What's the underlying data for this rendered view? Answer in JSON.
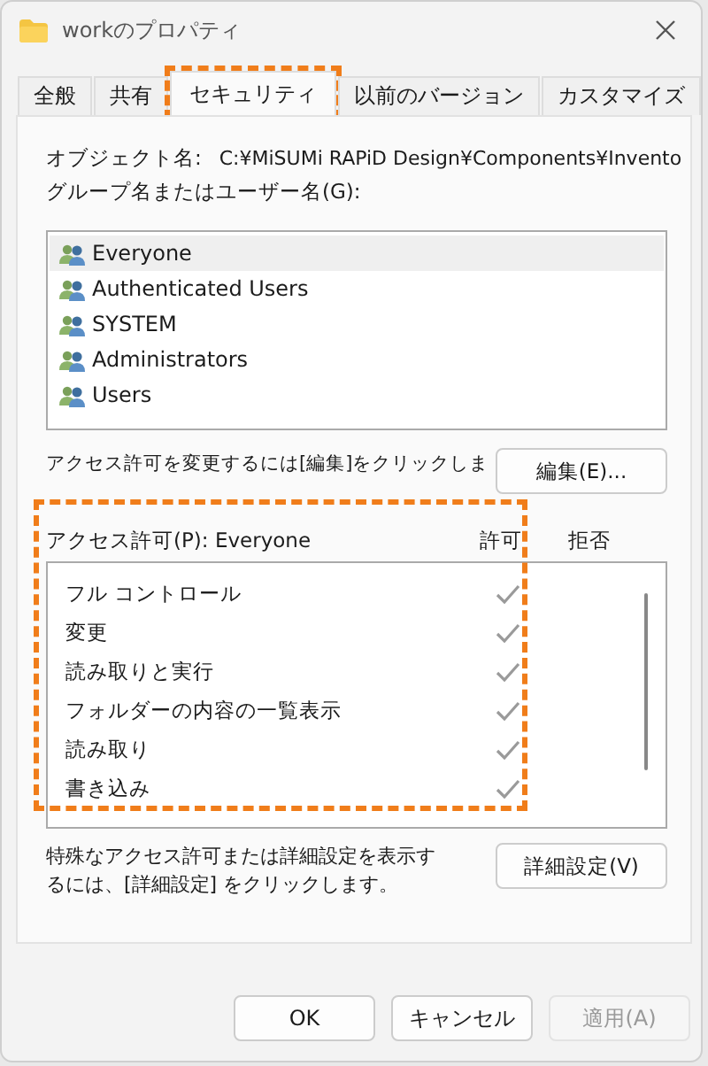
{
  "window": {
    "title": "workのプロパティ"
  },
  "tabs": [
    {
      "label": "全般",
      "selected": false,
      "highlighted": false
    },
    {
      "label": "共有",
      "selected": false,
      "highlighted": false
    },
    {
      "label": "セキュリティ",
      "selected": true,
      "highlighted": true
    },
    {
      "label": "以前のバージョン",
      "selected": false,
      "highlighted": false
    },
    {
      "label": "カスタマイズ",
      "selected": false,
      "highlighted": false
    }
  ],
  "object_name": {
    "label": "オブジェクト名:",
    "value": "C:¥MiSUMi RAPiD Design¥Components¥Invento"
  },
  "groups": {
    "label": "グループ名またはユーザー名(G):",
    "items": [
      {
        "name": "Everyone",
        "selected": true
      },
      {
        "name": "Authenticated Users",
        "selected": false
      },
      {
        "name": "SYSTEM",
        "selected": false
      },
      {
        "name": "Administrators",
        "selected": false
      },
      {
        "name": "Users",
        "selected": false
      }
    ]
  },
  "edit_hint": "アクセス許可を変更するには[編集]をクリックしま",
  "edit_button": "編集(E)...",
  "permissions": {
    "label": "アクセス許可(P): Everyone",
    "allow_header": "許可",
    "deny_header": "拒否",
    "highlighted": true,
    "items": [
      {
        "name": "フル コントロール",
        "allow": true,
        "deny": false
      },
      {
        "name": "変更",
        "allow": true,
        "deny": false
      },
      {
        "name": "読み取りと実行",
        "allow": true,
        "deny": false
      },
      {
        "name": "フォルダーの内容の一覧表示",
        "allow": true,
        "deny": false
      },
      {
        "name": "読み取り",
        "allow": true,
        "deny": false
      },
      {
        "name": "書き込み",
        "allow": true,
        "deny": false
      }
    ]
  },
  "advanced_hint": "特殊なアクセス許可または詳細設定を表示するには、[詳細設定] をクリックします。",
  "advanced_button": "詳細設定(V)",
  "buttons": [
    {
      "label": "OK",
      "disabled": false
    },
    {
      "label": "キャンセル",
      "disabled": false
    },
    {
      "label": "適用(A)",
      "disabled": true
    }
  ]
}
